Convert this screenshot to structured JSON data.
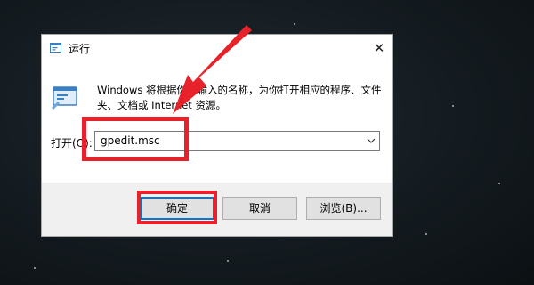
{
  "dialog": {
    "title": "运行",
    "description": "Windows 将根据你所输入的名称，为你打开相应的程序、文件夹、文档或 Internet 资源。",
    "open_label": "打开(O):",
    "input_value": "gpedit.msc",
    "ok_label": "确定",
    "cancel_label": "取消",
    "browse_label": "浏览(B)...",
    "close_glyph": "✕"
  },
  "colors": {
    "annotation": "#e8222a",
    "focus_border": "#0078d7",
    "background": "#141b20"
  },
  "icons": [
    "run-app-icon",
    "run-dialog-icon",
    "chevron-down-icon",
    "close-icon"
  ]
}
